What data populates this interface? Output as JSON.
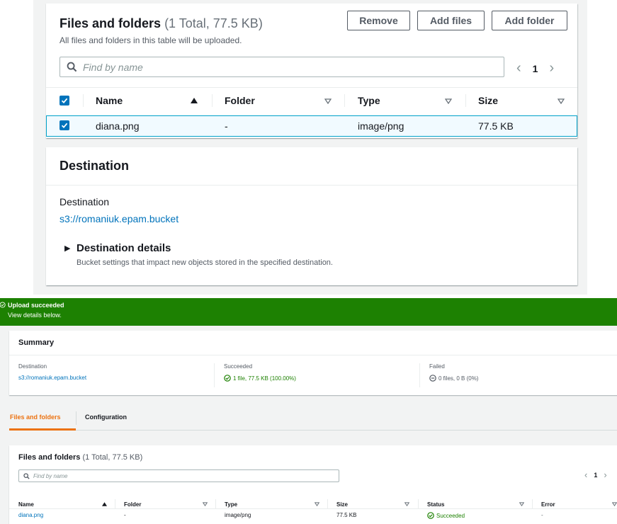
{
  "upload_page": {
    "files_section": {
      "title": "Files and folders",
      "count": "(1 Total, 77.5 KB)",
      "description": "All files and folders in this table will be uploaded.",
      "buttons": {
        "remove": "Remove",
        "add_files": "Add files",
        "add_folder": "Add folder"
      },
      "search_placeholder": "Find by name",
      "page": "1",
      "columns": [
        "Name",
        "Folder",
        "Type",
        "Size"
      ],
      "rows": [
        {
          "name": "diana.png",
          "folder": "-",
          "type": "image/png",
          "size": "77.5 KB",
          "selected": true
        }
      ]
    },
    "destination_section": {
      "title": "Destination",
      "label": "Destination",
      "link": "s3://romaniuk.epam.bucket",
      "details_title": "Destination details",
      "details_description": "Bucket settings that impact new objects stored in the specified destination."
    }
  },
  "status_page": {
    "flash": {
      "title": "Upload succeeded",
      "message": "View details below."
    },
    "summary": {
      "title": "Summary",
      "destination_label": "Destination",
      "destination_value": "s3://romaniuk.epam.bucket",
      "succeeded_label": "Succeeded",
      "succeeded_value": "1 file, 77.5 KB (100.00%)",
      "failed_label": "Failed",
      "failed_value": "0 files, 0 B (0%)"
    },
    "tabs": [
      "Files and folders",
      "Configuration"
    ],
    "files_section": {
      "title": "Files and folders",
      "count": "(1 Total, 77.5 KB)",
      "search_placeholder": "Find by name",
      "page": "1",
      "columns": [
        "Name",
        "Folder",
        "Type",
        "Size",
        "Status",
        "Error"
      ],
      "rows": [
        {
          "name": "diana.png",
          "folder": "-",
          "type": "image/png",
          "size": "77.5 KB",
          "status": "Succeeded",
          "error": "-"
        }
      ]
    }
  },
  "colors": {
    "link": "#0073bb",
    "success": "#1d8102",
    "accent_tab": "#ec7211",
    "selected_row_border": "#00a1c9"
  }
}
